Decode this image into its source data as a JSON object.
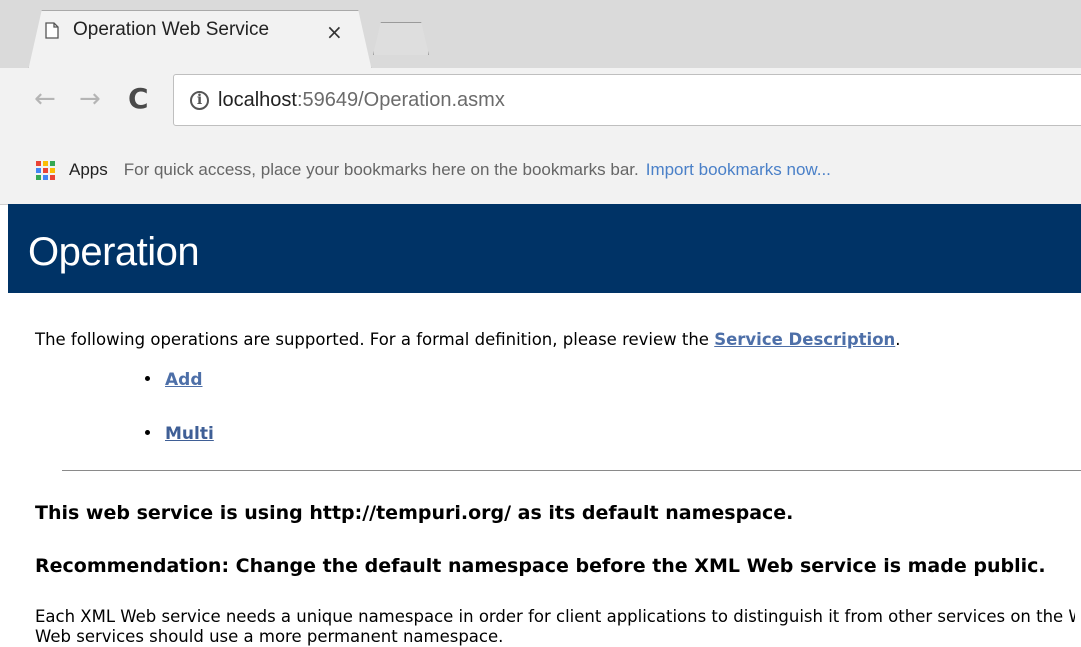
{
  "browser": {
    "tab": {
      "title": "Operation Web Service",
      "close_symbol": "×"
    },
    "nav": {
      "back": "←",
      "forward": "→",
      "reload": "C"
    },
    "address": {
      "info_symbol": "i",
      "host": "localhost",
      "rest": ":59649/Operation.asmx"
    },
    "bookmarks": {
      "apps_label": "Apps",
      "hint": "For quick access, place your bookmarks here on the bookmarks bar.",
      "import_link": "Import bookmarks now..."
    }
  },
  "page": {
    "heading": "Operation",
    "intro_text": "The following operations are supported. For a formal definition, please review the ",
    "service_description_link": "Service Description",
    "intro_period": ".",
    "operations": [
      "Add",
      "Multi"
    ],
    "namespace_text": "This web service is using http://tempuri.org/ as its default namespace.",
    "recommendation_text": "Recommendation: Change the default namespace before the XML Web service is made public.",
    "body_line1": "Each XML Web service needs a unique namespace in order for client applications to distinguish it from other services on the Web.",
    "body_line2": "Web services should use a more permanent namespace."
  },
  "colors": {
    "heading_bar": "#003366",
    "link": "#4d6fa8",
    "apps_grid": [
      "#ea4335",
      "#fbbc05",
      "#34a853",
      "#4285f4",
      "#ea4335",
      "#fbbc05",
      "#34a853",
      "#4285f4",
      "#ea4335"
    ]
  }
}
